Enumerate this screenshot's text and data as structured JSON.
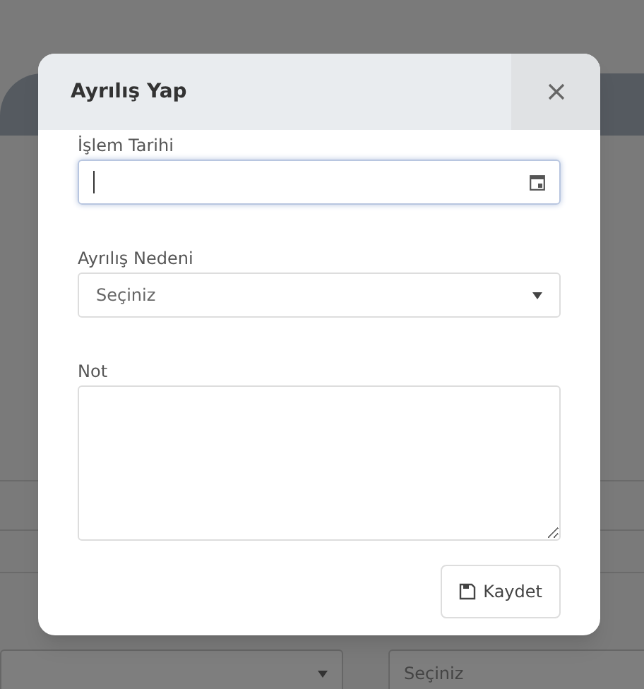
{
  "background_page": {
    "selects": [
      {
        "caret": true
      },
      {
        "value": "Seçiniz",
        "caret": false
      }
    ]
  },
  "modal": {
    "title": "Ayrılış Yap",
    "fields": [
      {
        "kind": "date",
        "label": "İşlem Tarihi",
        "focused": true
      },
      {
        "kind": "select",
        "label": "Ayrılış Nedeni",
        "value": "Seçiniz"
      },
      {
        "kind": "textarea",
        "label": "Not"
      }
    ],
    "save_button": {
      "label": "Kaydet"
    }
  }
}
